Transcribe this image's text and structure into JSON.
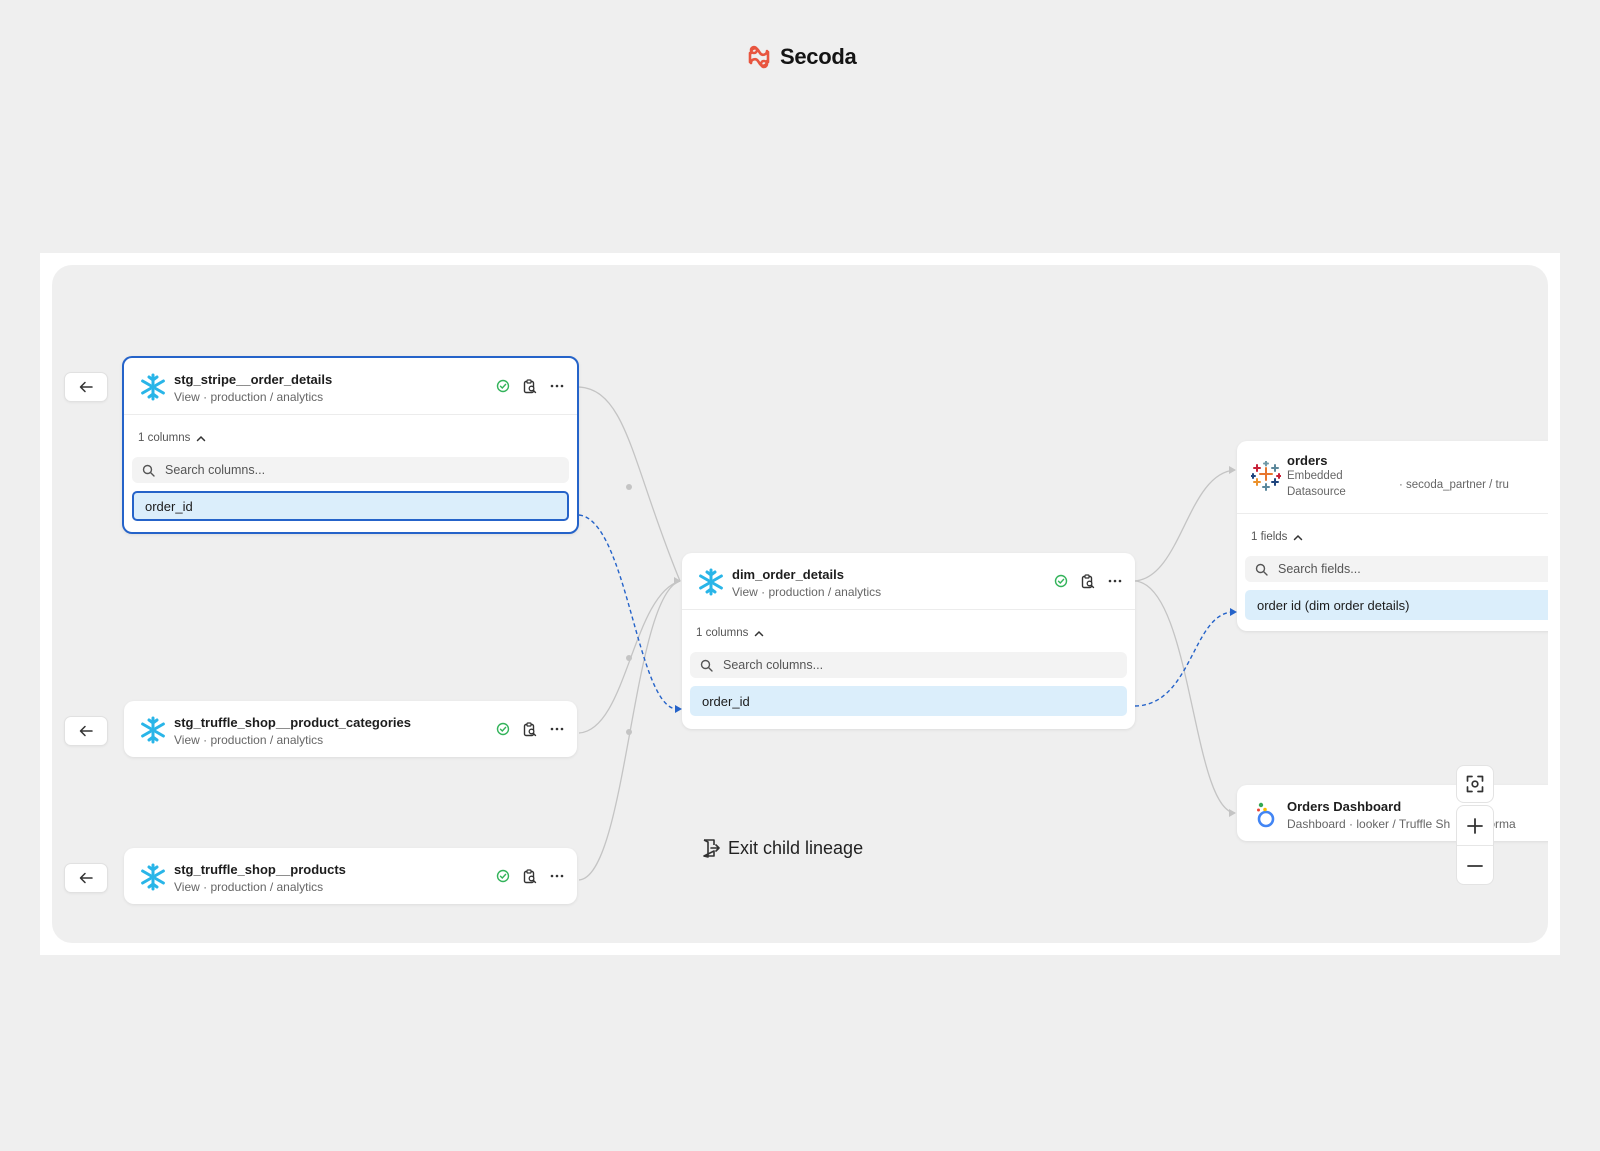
{
  "brand": {
    "name": "Secoda"
  },
  "colors": {
    "brand": "#e8553f",
    "accent": "#2563c9",
    "column_bg": "#dbeefb",
    "status_ok": "#33b35a",
    "snowflake": "#29b5e8"
  },
  "nodes": {
    "stripe": {
      "title": "stg_stripe__order_details",
      "subtitle": "View · production / analytics",
      "columns_toggle": "1 columns",
      "search_placeholder": "Search columns...",
      "columns": [
        "order_id"
      ],
      "icon": "snowflake-icon"
    },
    "categories": {
      "title": "stg_truffle_shop__product_categories",
      "subtitle": "View · production / analytics",
      "icon": "snowflake-icon"
    },
    "products": {
      "title": "stg_truffle_shop__products",
      "subtitle": "View · production / analytics",
      "icon": "snowflake-icon"
    },
    "dim": {
      "title": "dim_order_details",
      "subtitle": "View · production / analytics",
      "columns_toggle": "1 columns",
      "search_placeholder": "Search columns...",
      "columns": [
        "order_id"
      ],
      "icon": "snowflake-icon"
    },
    "orders": {
      "title": "orders",
      "subtitle_line1": "Embedded",
      "subtitle_line2": "Datasource",
      "path": "· secoda_partner / tru",
      "fields_toggle": "1 fields",
      "search_placeholder": "Search fields...",
      "fields": [
        "order id (dim order details)"
      ],
      "icon": "tableau-icon"
    },
    "dashboard": {
      "title": "Orders Dashboard",
      "subtitle": "Dashboard · looker / Truffle Sh",
      "subtitle_tail": "forma",
      "icon": "looker-icon"
    }
  },
  "canvas": {
    "exit_label": "Exit child lineage",
    "zoom_tools": [
      "fit-view-icon",
      "zoom-in-icon",
      "zoom-out-icon"
    ]
  }
}
